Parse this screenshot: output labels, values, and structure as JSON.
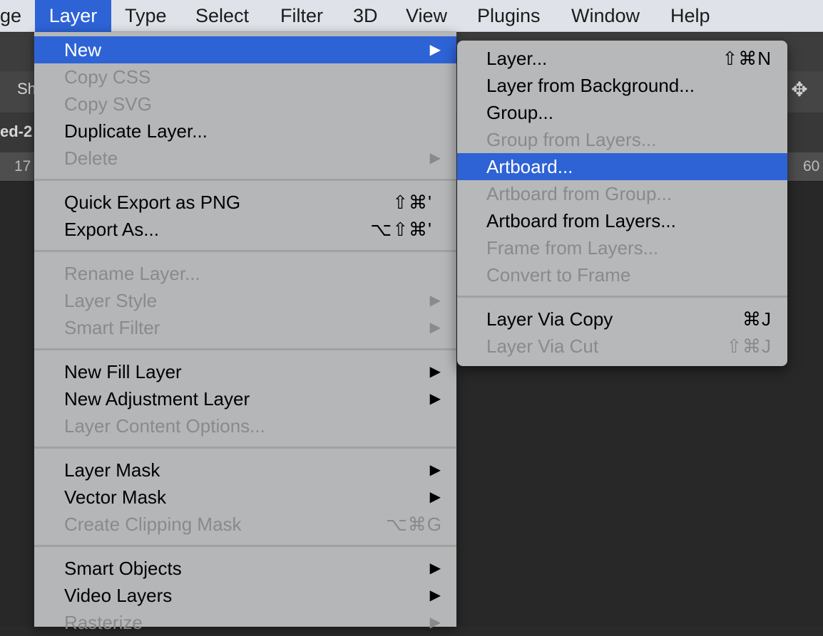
{
  "menubar": {
    "items": [
      {
        "label": "ge"
      },
      {
        "label": "Layer"
      },
      {
        "label": "Type"
      },
      {
        "label": "Select"
      },
      {
        "label": "Filter"
      },
      {
        "label": "3D"
      },
      {
        "label": "View"
      },
      {
        "label": "Plugins"
      },
      {
        "label": "Window"
      },
      {
        "label": "Help"
      }
    ]
  },
  "background": {
    "option_checkbox_label": "Sh",
    "doc_tab_fragment": "ed-2",
    "ruler_left": "17",
    "ruler_right": "60",
    "move_icon": "✥"
  },
  "layer_menu": {
    "items": [
      {
        "label": "New",
        "arrow": "▶"
      },
      {
        "label": "Copy CSS"
      },
      {
        "label": "Copy SVG"
      },
      {
        "label": "Duplicate Layer..."
      },
      {
        "label": "Delete",
        "arrow": "▶"
      },
      {
        "label": "Quick Export as PNG",
        "shortcut": "⇧⌘'"
      },
      {
        "label": "Export As...",
        "shortcut": "⌥⇧⌘'"
      },
      {
        "label": "Rename Layer..."
      },
      {
        "label": "Layer Style",
        "arrow": "▶"
      },
      {
        "label": "Smart Filter",
        "arrow": "▶"
      },
      {
        "label": "New Fill Layer",
        "arrow": "▶"
      },
      {
        "label": "New Adjustment Layer",
        "arrow": "▶"
      },
      {
        "label": "Layer Content Options..."
      },
      {
        "label": "Layer Mask",
        "arrow": "▶"
      },
      {
        "label": "Vector Mask",
        "arrow": "▶"
      },
      {
        "label": "Create Clipping Mask",
        "shortcut": "⌥⌘G"
      },
      {
        "label": "Smart Objects",
        "arrow": "▶"
      },
      {
        "label": "Video Layers",
        "arrow": "▶"
      },
      {
        "label": "Rasterize",
        "arrow": "▶"
      }
    ]
  },
  "new_submenu": {
    "items": [
      {
        "label": "Layer...",
        "shortcut": "⇧⌘N"
      },
      {
        "label": "Layer from Background..."
      },
      {
        "label": "Group..."
      },
      {
        "label": "Group from Layers..."
      },
      {
        "label": "Artboard..."
      },
      {
        "label": "Artboard from Group..."
      },
      {
        "label": "Artboard from Layers..."
      },
      {
        "label": "Frame from Layers..."
      },
      {
        "label": "Convert to Frame"
      },
      {
        "label": "Layer Via Copy",
        "shortcut": "⌘J"
      },
      {
        "label": "Layer Via Cut",
        "shortcut": "⇧⌘J"
      }
    ]
  },
  "colors": {
    "highlight": "#2e63d6",
    "menu_bg": "#b5b6b8",
    "disabled_text": "#888a8d"
  }
}
